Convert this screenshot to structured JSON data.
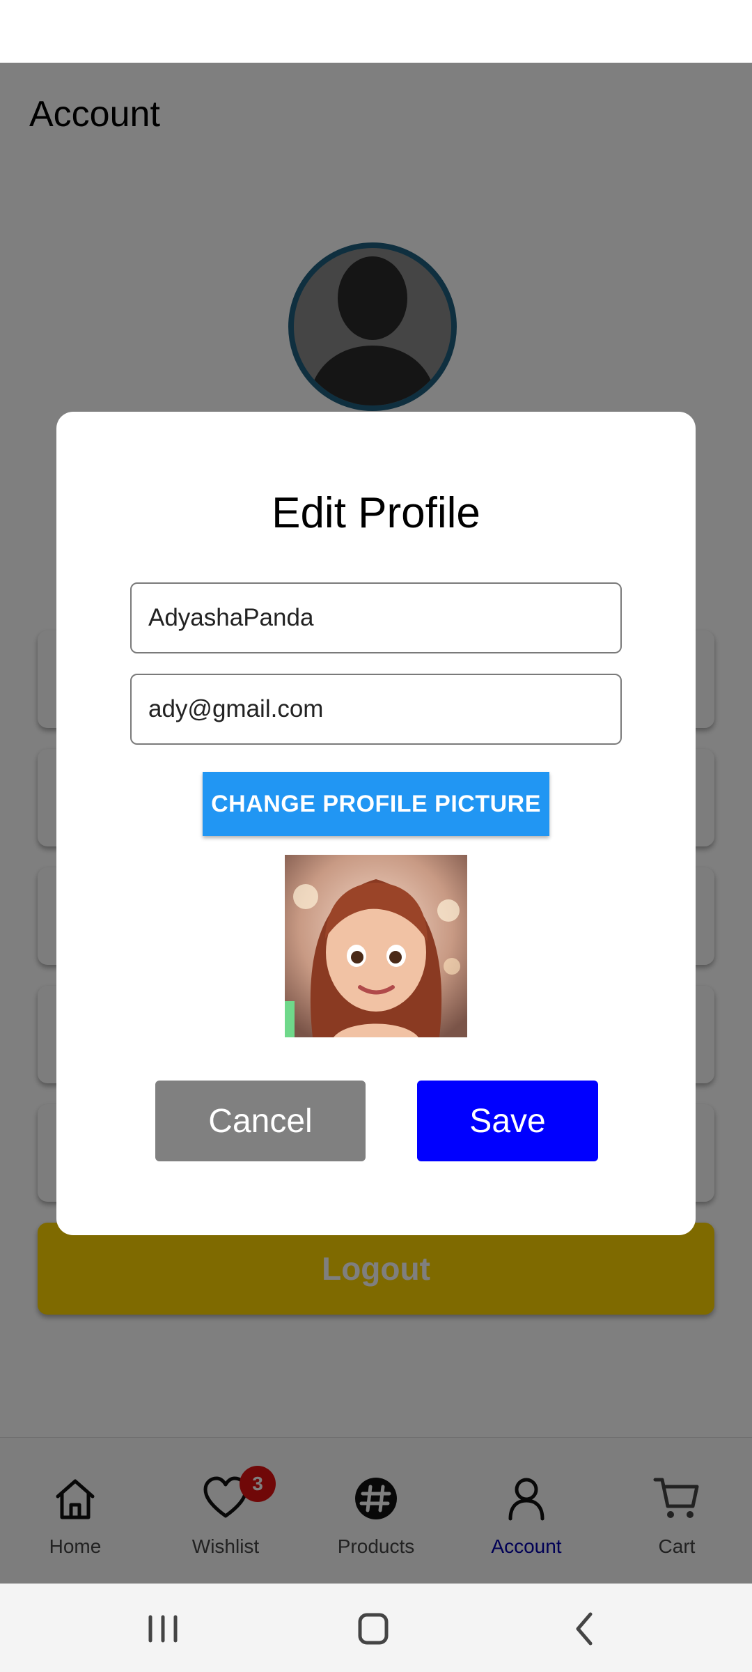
{
  "app": {
    "page_title": "Account",
    "logout_label": "Logout"
  },
  "bottom_nav": {
    "items": [
      {
        "label": "Home",
        "icon": "home-icon"
      },
      {
        "label": "Wishlist",
        "icon": "heart-icon",
        "badge": "3"
      },
      {
        "label": "Products",
        "icon": "products-icon"
      },
      {
        "label": "Account",
        "icon": "account-icon",
        "active": true
      },
      {
        "label": "Cart",
        "icon": "cart-icon"
      }
    ]
  },
  "dialog": {
    "title": "Edit Profile",
    "username_value": "AdyashaPanda",
    "email_value": "ady@gmail.com",
    "change_picture_label": "CHANGE PROFILE PICTURE",
    "cancel_label": "Cancel",
    "save_label": "Save"
  },
  "colors": {
    "accent_blue": "#2196f3",
    "save_blue": "#0000ff",
    "cancel_gray": "#808080",
    "logout_yellow": "#ffd400",
    "active_nav": "#0000aa",
    "badge_red": "#e01010"
  }
}
